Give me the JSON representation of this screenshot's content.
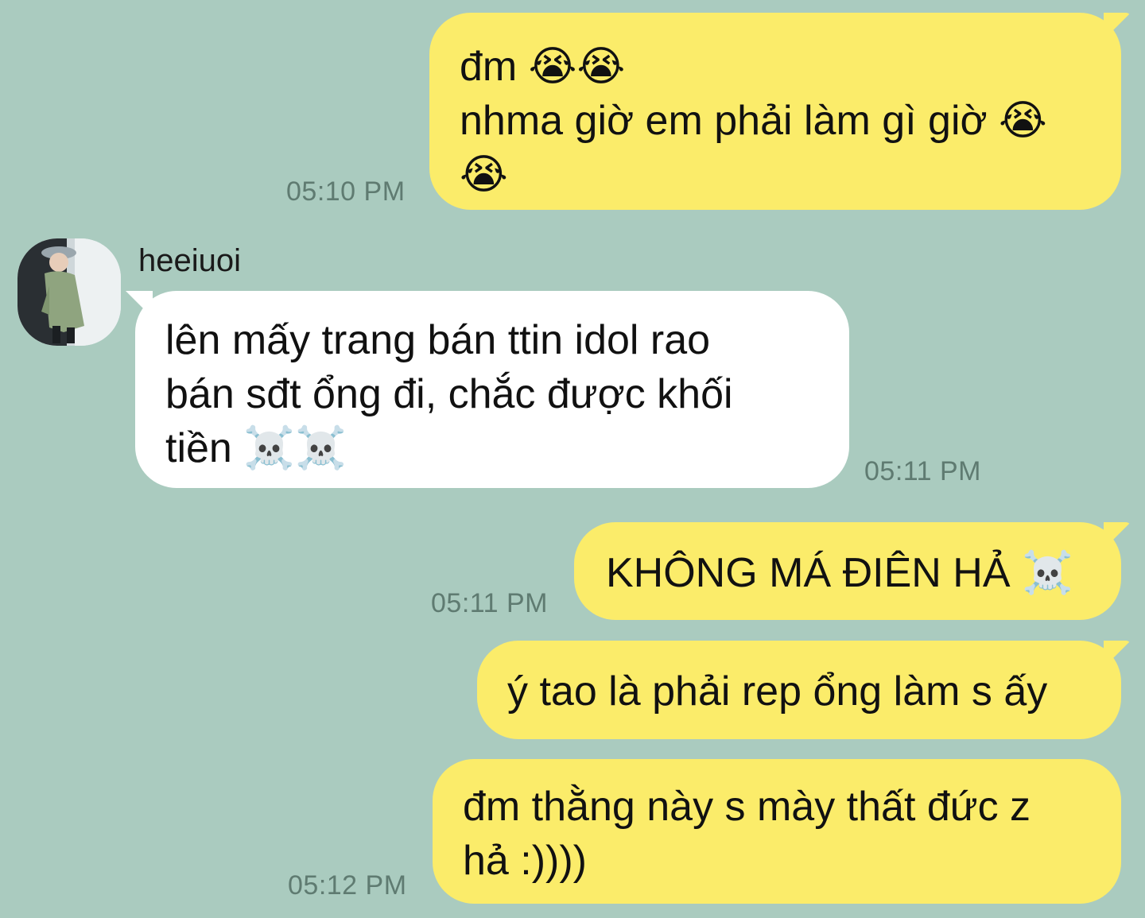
{
  "messages": [
    {
      "direction": "outgoing",
      "text": "đm 😭😭\nnhma giờ em phải làm gì giờ 😭\n😭",
      "time": "05:10 PM"
    },
    {
      "direction": "incoming",
      "sender": "heeiuoi",
      "text": "lên mấy trang bán ttin idol rao\nbán sđt ổng đi, chắc được khối\ntiền ☠️☠️",
      "time": "05:11 PM"
    },
    {
      "direction": "outgoing",
      "text": "KHÔNG MÁ ĐIÊN HẢ ☠️",
      "time": "05:11 PM"
    },
    {
      "direction": "outgoing",
      "text": "ý tao là phải rep ổng làm s ấy",
      "time": ""
    },
    {
      "direction": "outgoing",
      "text": "đm thằng này s mày thất đức z\nhả :))))",
      "time": "05:12 PM"
    }
  ],
  "contact": {
    "name": "heeiuoi",
    "avatar_icon": "user-avatar-photo"
  },
  "colors": {
    "background": "#aacbbf",
    "outgoing_bubble": "#fbec6a",
    "incoming_bubble": "#ffffff",
    "timestamp": "#5f7b71"
  }
}
